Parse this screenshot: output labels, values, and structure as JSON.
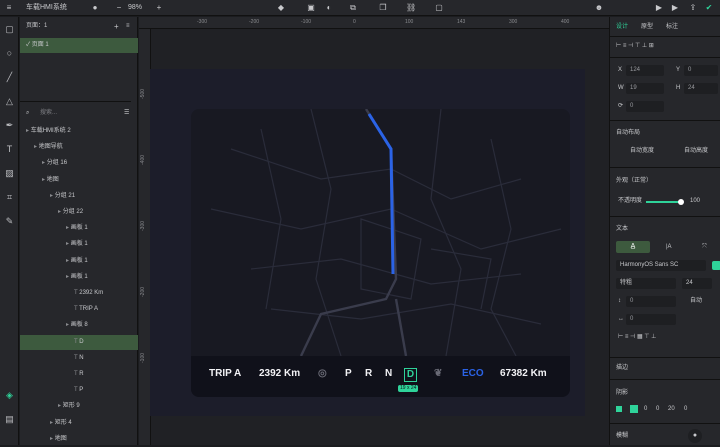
{
  "topbar": {
    "project_name": "车载HMI系统",
    "zoom": "98%",
    "selection_hint": ""
  },
  "layers_panel": {
    "pages_label": "页面：1",
    "page_item": "页面 1",
    "search_placeholder": "搜索...",
    "tree": [
      {
        "label": "车载HMI系统 2",
        "indent": 0
      },
      {
        "label": "地图导航",
        "indent": 1
      },
      {
        "label": "分组 16",
        "indent": 2
      },
      {
        "label": "地图",
        "indent": 2
      },
      {
        "label": "分组 21",
        "indent": 3
      },
      {
        "label": "分组 22",
        "indent": 4
      },
      {
        "label": "画板 1",
        "indent": 5
      },
      {
        "label": "画板 1",
        "indent": 5
      },
      {
        "label": "画板 1",
        "indent": 5
      },
      {
        "label": "画板 1",
        "indent": 5
      },
      {
        "label": "2392 Km",
        "indent": 6
      },
      {
        "label": "TRIP A",
        "indent": 6
      },
      {
        "label": "画板 8",
        "indent": 5
      },
      {
        "label": "D",
        "indent": 6,
        "selected": true
      },
      {
        "label": "N",
        "indent": 6
      },
      {
        "label": "R",
        "indent": 6
      },
      {
        "label": "P",
        "indent": 6
      },
      {
        "label": "矩形 9",
        "indent": 4
      },
      {
        "label": "矩形 4",
        "indent": 3
      },
      {
        "label": "地图",
        "indent": 3
      }
    ]
  },
  "canvas": {
    "ruler_top": [
      "-300",
      "-200",
      "-100",
      "0",
      "100",
      "143",
      "300",
      "400",
      "500"
    ],
    "ruler_left": [
      "-500",
      "-400",
      "-300",
      "-200",
      "-100"
    ],
    "hud": {
      "trip_label": "TRIP A",
      "trip_value": "2392 Km",
      "gear_p": "P",
      "gear_r": "R",
      "gear_n": "N",
      "gear_d": "D",
      "size_badge": "19 x 24",
      "eco_label": "ECO",
      "odometer": "67382 Km"
    }
  },
  "props_panel": {
    "tabs": [
      "设计",
      "原型",
      "标注"
    ],
    "x_label": "X",
    "x_value": "124",
    "y_label": "Y",
    "y_value": "0",
    "w_label": "W",
    "w_value": "19",
    "h_label": "H",
    "h_value": "24",
    "rotation": "0",
    "auto_layout_title": "自动布局",
    "auto_width": "自动宽度",
    "auto_height": "自动高度",
    "appearance_title": "外观（正常）",
    "opacity_label": "不透明度",
    "opacity_value": "100",
    "text_title": "文本",
    "font_family": "HarmonyOS Sans SC",
    "font_weight": "特粗",
    "font_size": "24",
    "line_height": "0",
    "line_height_auto": "自动",
    "letter_spacing": "0",
    "stroke_title": "描边",
    "shadow_title": "阴影",
    "shadow_values": [
      "0",
      "0",
      "20",
      "0"
    ],
    "blur_title": "模糊",
    "accent": "#2fd39a"
  }
}
